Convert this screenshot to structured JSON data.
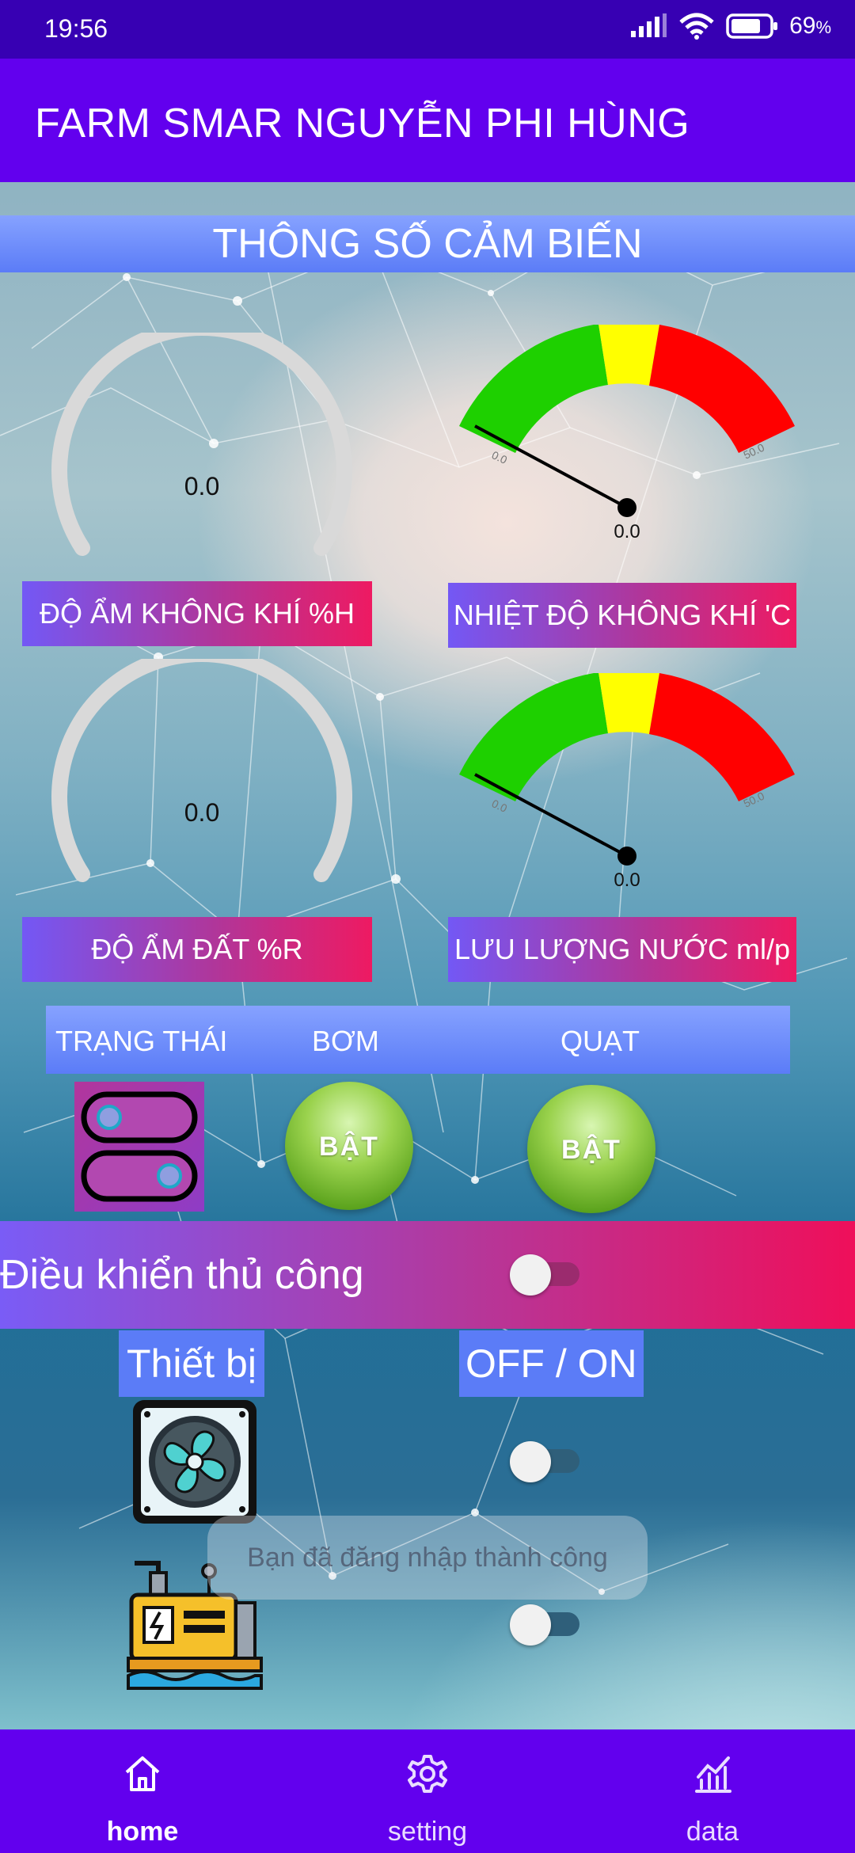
{
  "status_bar": {
    "time": "19:56",
    "battery": "69",
    "battery_unit": "%"
  },
  "app_bar": {
    "title": "FARM SMAR NGUYỄN PHI HÙNG"
  },
  "sensor_section": {
    "header": "THÔNG SỐ CẢM BIẾN",
    "air_humidity": {
      "value": "0.0",
      "label": "ĐỘ ẨM KHÔNG KHÍ %H"
    },
    "air_temperature": {
      "value": "0.0",
      "label": "NHIỆT ĐỘ KHÔNG KHÍ 'C",
      "scale_min": "0.0",
      "scale_max": "50.0"
    },
    "soil_moisture": {
      "value": "0.0",
      "label": "ĐỘ ẨM ĐẤT %R"
    },
    "water_flow": {
      "value": "0.0",
      "label": "LƯU LƯỢNG NƯỚC ml/p",
      "scale_min": "0.0",
      "scale_max": "50.0"
    }
  },
  "status_row": {
    "status_label": "TRẠNG THÁI",
    "pump_label": "BƠM",
    "fan_label": "QUẠT"
  },
  "buttons": {
    "pump_button": "BẬT",
    "fan_button": "BẬT"
  },
  "manual": {
    "label": "Điều khiển thủ công",
    "enabled": false
  },
  "devices": {
    "device_header": "Thiết bị",
    "state_header": "OFF / ON",
    "items": [
      {
        "icon": "fan-icon",
        "on": false
      },
      {
        "icon": "water-pump-icon",
        "on": false
      }
    ]
  },
  "toast": {
    "message": "Bạn đã đăng nhập thành công"
  },
  "bottom_nav": {
    "items": [
      {
        "label": "home",
        "icon": "home-icon"
      },
      {
        "label": "setting",
        "icon": "gear-icon"
      },
      {
        "label": "data",
        "icon": "chart-icon"
      }
    ]
  },
  "colors": {
    "primary": "#6200ee",
    "status_bar": "#3700b3",
    "accent_pink": "#ef0f5a",
    "blue_header": "#5b7cf7",
    "gauge_green": "#1ed000",
    "gauge_yellow": "#ffff00",
    "gauge_red": "#ff0000"
  }
}
